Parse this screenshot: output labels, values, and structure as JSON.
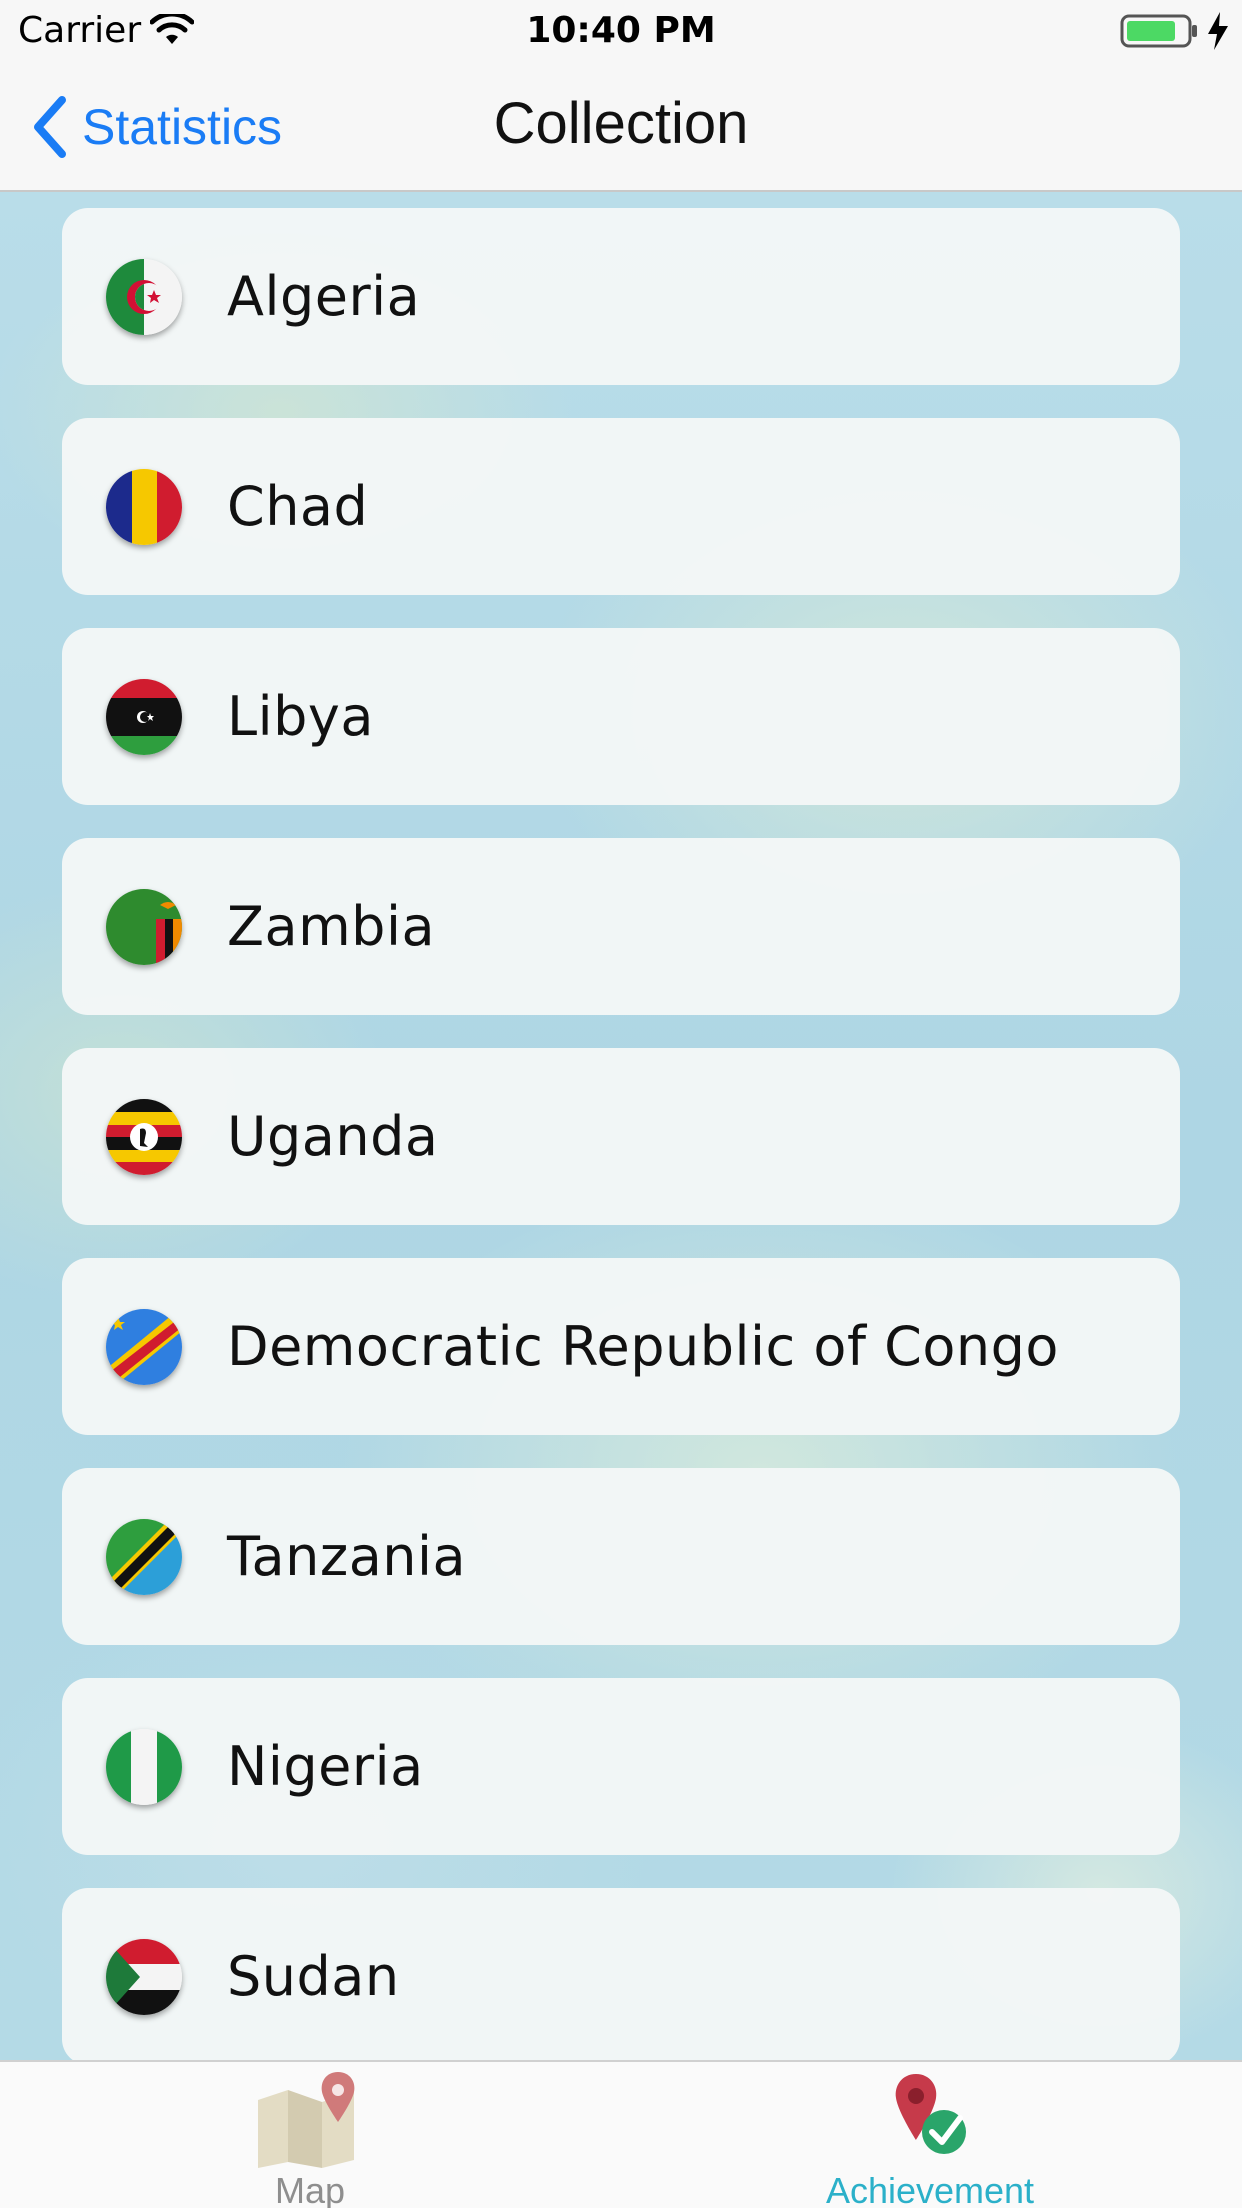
{
  "status_bar": {
    "carrier": "Carrier",
    "time": "10:40 PM",
    "battery_color": "#4cd964"
  },
  "nav": {
    "back_label": "Statistics",
    "title": "Collection",
    "accent_color": "#1a7cf5"
  },
  "countries": [
    {
      "name": "Algeria",
      "flag": "algeria-flag-icon"
    },
    {
      "name": "Chad",
      "flag": "chad-flag-icon"
    },
    {
      "name": "Libya",
      "flag": "libya-flag-icon"
    },
    {
      "name": "Zambia",
      "flag": "zambia-flag-icon"
    },
    {
      "name": "Uganda",
      "flag": "uganda-flag-icon"
    },
    {
      "name": "Democratic Republic of Congo",
      "flag": "drc-flag-icon"
    },
    {
      "name": "Tanzania",
      "flag": "tanzania-flag-icon"
    },
    {
      "name": "Nigeria",
      "flag": "nigeria-flag-icon"
    },
    {
      "name": "Sudan",
      "flag": "sudan-flag-icon"
    }
  ],
  "tabs": [
    {
      "label": "Map",
      "icon": "map-icon",
      "selected": false
    },
    {
      "label": "Achievement",
      "icon": "achievement-icon",
      "selected": true
    }
  ],
  "tab_selected_color": "#2bb0c9"
}
